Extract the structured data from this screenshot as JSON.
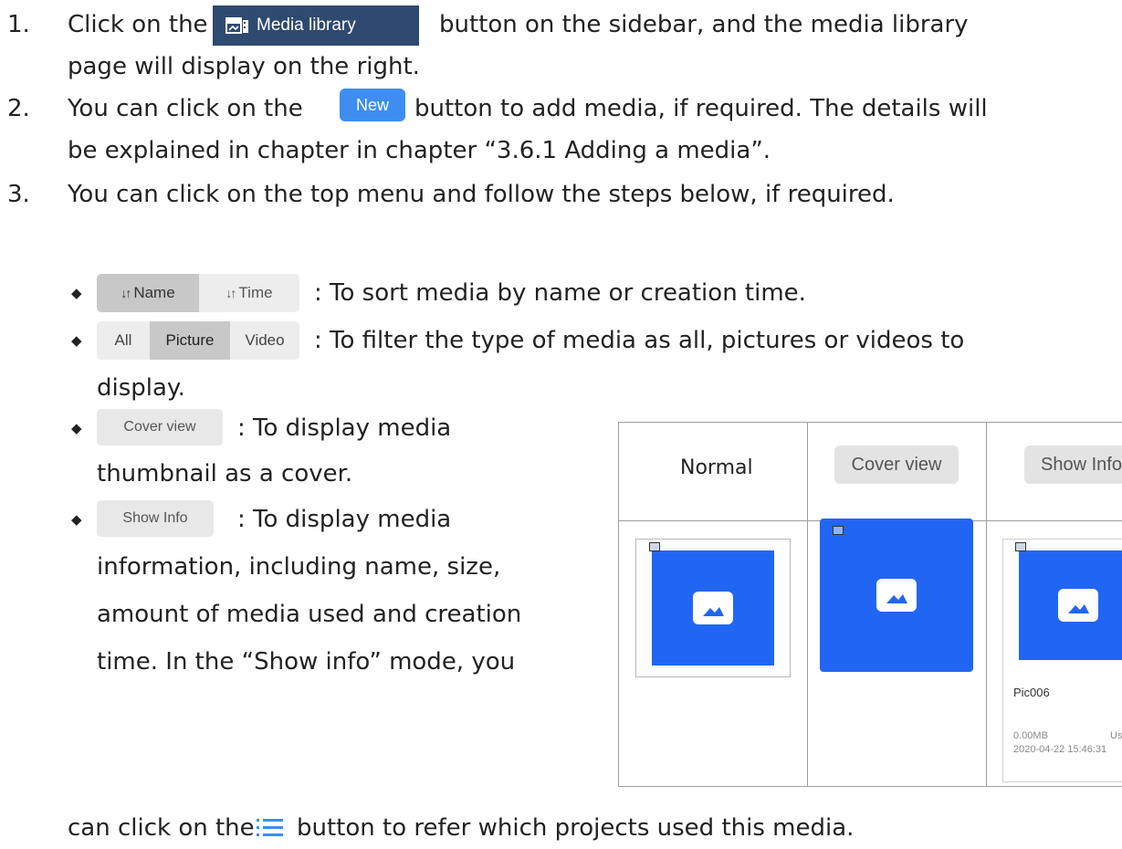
{
  "steps": [
    {
      "num": "1.",
      "line1_pre": "Click on the",
      "button": "Media library",
      "line1_post": "button on the sidebar, and the media library",
      "line2": "page will display on the right."
    },
    {
      "num": "2.",
      "line1_pre": "You can click on the",
      "button": "New",
      "line1_post": "button to add media, if required. The details will",
      "line2": "be explained in chapter in chapter “3.6.1 Adding a media”."
    },
    {
      "num": "3.",
      "line1": "You can click on the top menu and follow the steps below, if required."
    }
  ],
  "sort": {
    "name": "Name",
    "time": "Time",
    "desc": ": To sort media by name or creation time."
  },
  "filter": {
    "all": "All",
    "picture": "Picture",
    "video": "Video",
    "desc": ": To filter the type of media as all, pictures or videos to",
    "desc2": "display."
  },
  "cover": {
    "label": "Cover view",
    "desc": ": To display media",
    "desc2": "thumbnail as a cover."
  },
  "info": {
    "label": "Show Info",
    "desc": ": To display media",
    "lines": [
      "information, including name, size,",
      "amount of media used and creation",
      "time. In the “Show info” mode, you"
    ]
  },
  "final": {
    "pre": "can click on the",
    "post": "button to refer which projects used this media."
  },
  "figure": {
    "col1": "Normal",
    "col2": "Cover view",
    "col3": "Show Info",
    "item_name": "Pic006",
    "size": "0.00MB",
    "used": "Use",
    "date": "2020-04-22 15:46:31"
  },
  "colors": {
    "thumb": "#2166f3",
    "new_button": "#3d8ef0",
    "media_button": "#2f4a70"
  },
  "icons": [
    "media-library-icon",
    "sort-arrows-icon",
    "image-icon",
    "list-icon"
  ]
}
